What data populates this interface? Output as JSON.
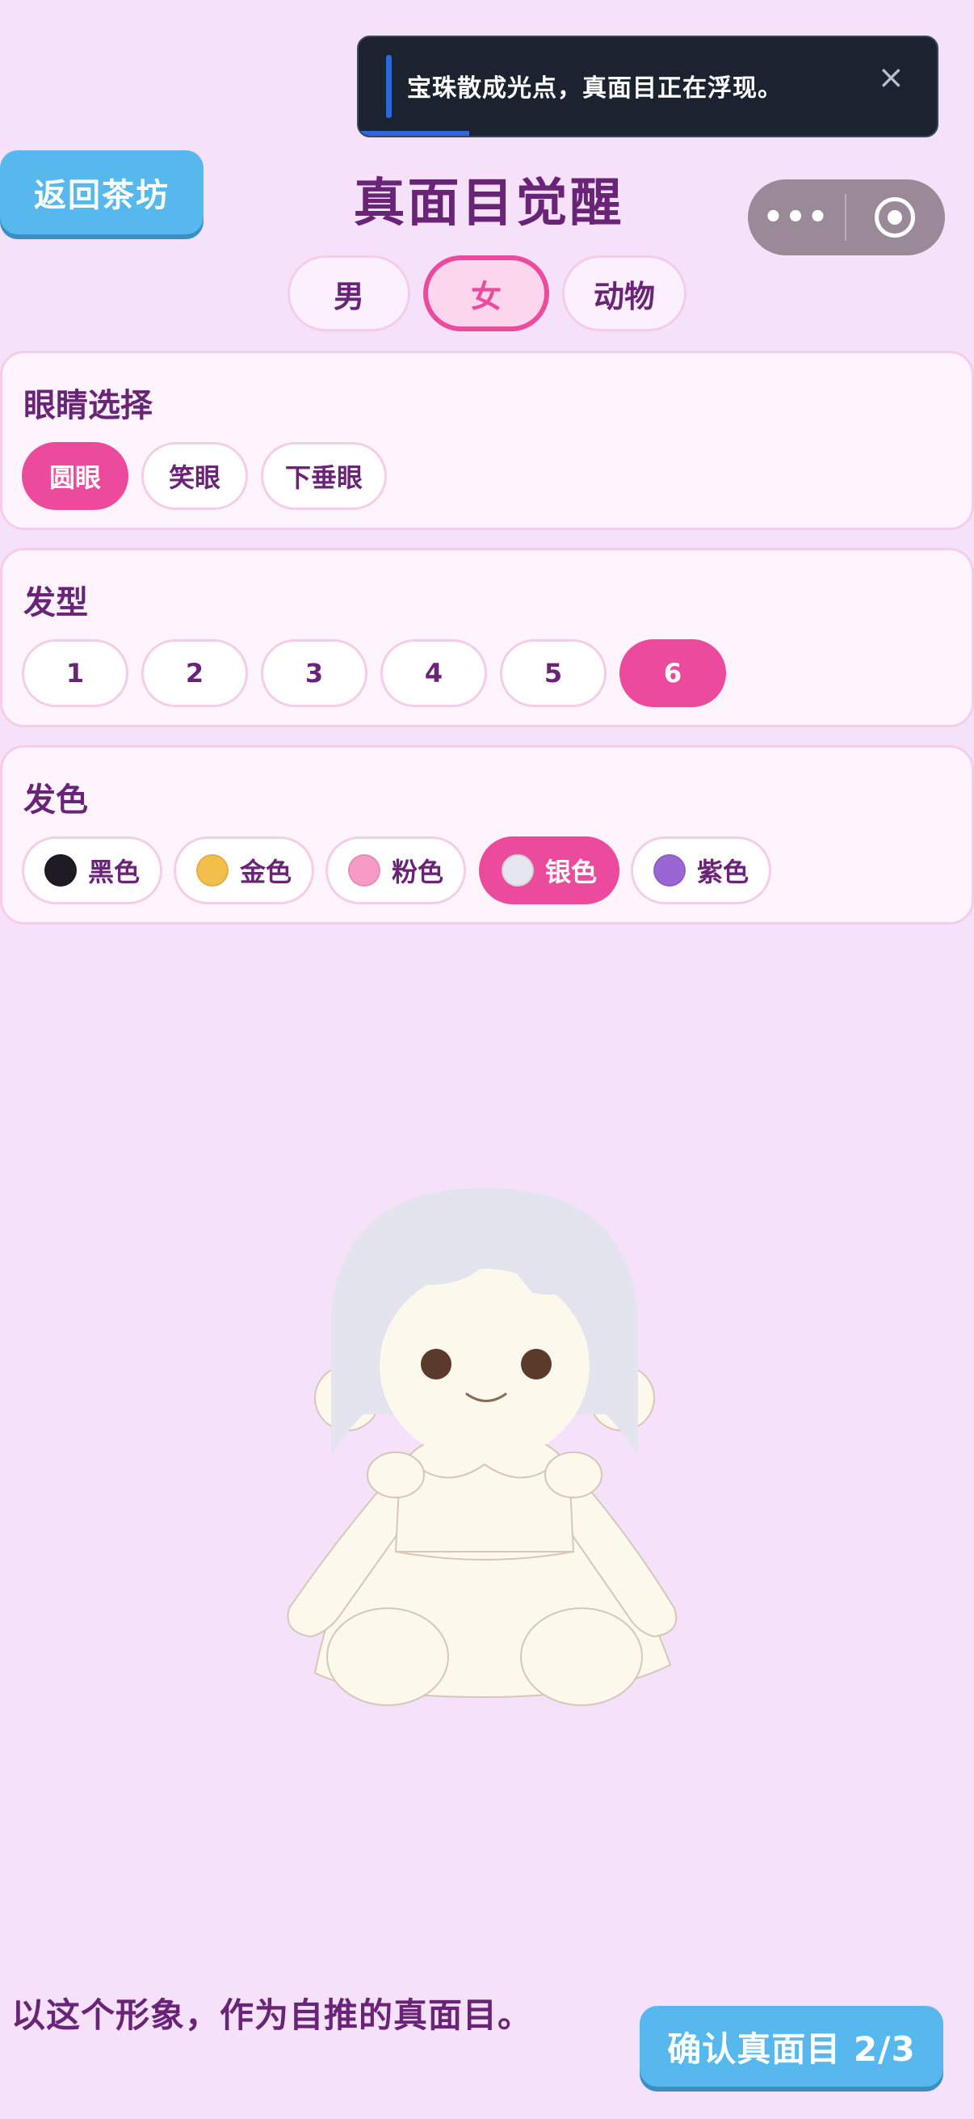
{
  "toast": {
    "message": "宝珠散成光点，真面目正在浮现。",
    "close_icon": "×",
    "progress": 0.19
  },
  "header": {
    "back_label": "返回茶坊",
    "title": "真面目觉醒",
    "more_icon": "•••"
  },
  "gender_tabs": {
    "male": "男",
    "female": "女",
    "animal": "动物",
    "selected": "女"
  },
  "eyes": {
    "title": "眼睛选择",
    "options": [
      "圆眼",
      "笑眼",
      "下垂眼"
    ],
    "selected": "圆眼"
  },
  "hairstyle": {
    "title": "发型",
    "options": [
      "1",
      "2",
      "3",
      "4",
      "5",
      "6"
    ],
    "selected": "6"
  },
  "hair_color": {
    "title": "发色",
    "options": [
      {
        "label": "黑色",
        "color": "#1f1a24"
      },
      {
        "label": "金色",
        "color": "#f3bf4c"
      },
      {
        "label": "粉色",
        "color": "#f79ac6"
      },
      {
        "label": "银色",
        "color": "#e6e6ee"
      },
      {
        "label": "紫色",
        "color": "#9a66d4"
      }
    ],
    "selected": "银色"
  },
  "preview": {
    "hair_color": "#e4e4ee",
    "body_color": "#fdf8ec"
  },
  "footer": {
    "prompt": "以这个形象，作为自推的真面目。",
    "confirm_label": "确认真面目 2/3"
  }
}
